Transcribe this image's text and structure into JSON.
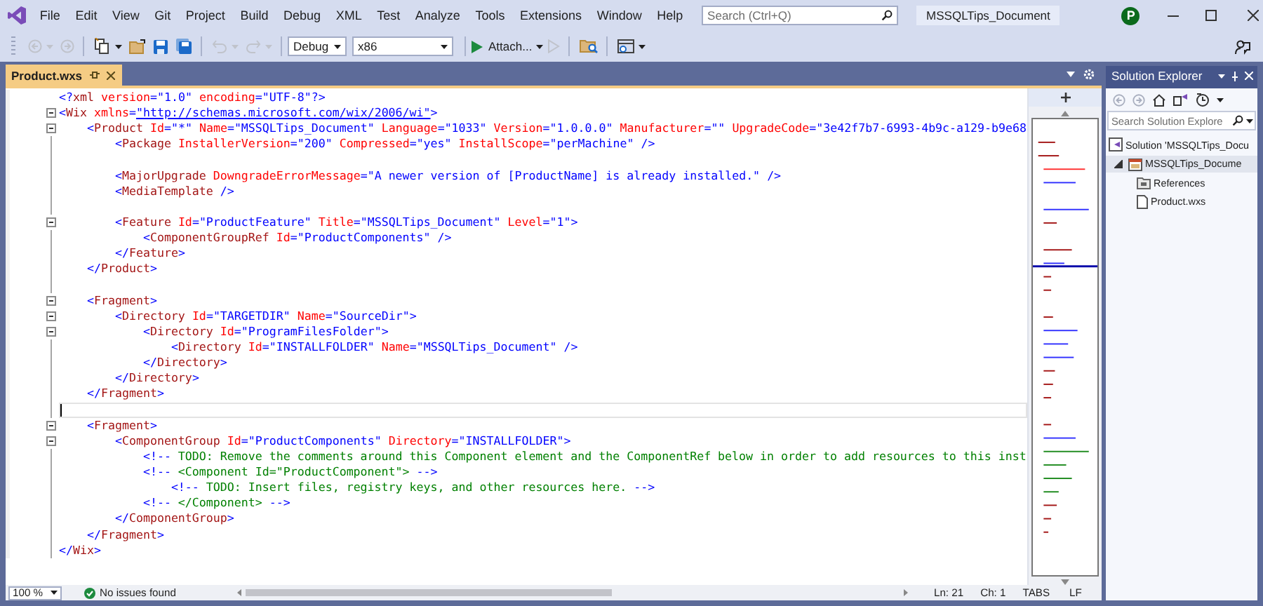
{
  "title_bar": {
    "menu": [
      "File",
      "Edit",
      "View",
      "Git",
      "Project",
      "Build",
      "Debug",
      "XML",
      "Test",
      "Analyze",
      "Tools",
      "Extensions",
      "Window",
      "Help"
    ],
    "search": {
      "placeholder": "Search (Ctrl+Q)"
    },
    "solution_name": "MSSQLTips_Document",
    "account_initial": "P"
  },
  "toolbar": {
    "items": [
      {
        "kind": "back",
        "disabled": true
      },
      {
        "kind": "forward",
        "disabled": true
      },
      {
        "kind": "new-item",
        "disabled": false
      },
      {
        "kind": "open",
        "disabled": false
      },
      {
        "kind": "save",
        "disabled": false
      },
      {
        "kind": "save-all",
        "disabled": false
      },
      {
        "kind": "undo",
        "disabled": true
      },
      {
        "kind": "redo",
        "disabled": true
      },
      {
        "kind": "combo",
        "label": "Debug"
      },
      {
        "kind": "combo",
        "label": "x86"
      },
      {
        "kind": "run",
        "label": "Attach..."
      },
      {
        "kind": "run-outline",
        "disabled": true
      },
      {
        "kind": "find",
        "disabled": false
      },
      {
        "kind": "layout",
        "disabled": false
      }
    ]
  },
  "editor": {
    "tabs": [
      {
        "label": "Product.wxs",
        "selected": true
      }
    ],
    "lines": [
      {
        "text": "<?xml version=\"1.0\" encoding=\"UTF-8\"?>",
        "fold": false,
        "current": false
      },
      {
        "text": "<Wix xmlns=\"http://schemas.microsoft.com/wix/2006/wi\">",
        "fold": true,
        "current": false
      },
      {
        "text": "    <Product Id=\"*\" Name=\"MSSQLTips_Document\" Language=\"1033\" Version=\"1.0.0.0\" Manufacturer=\"\" UpgradeCode=\"3e42f7b7-6993-4b9c-a129-b9e68",
        "fold": true,
        "current": false
      },
      {
        "text": "        <Package InstallerVersion=\"200\" Compressed=\"yes\" InstallScope=\"perMachine\" />",
        "fold": false,
        "current": false
      },
      {
        "fold": false,
        "current": false
      },
      {
        "text": "        <MajorUpgrade DowngradeErrorMessage=\"A newer version of [ProductName] is already installed.\" />",
        "fold": false,
        "current": false
      },
      {
        "text": "        <MediaTemplate />",
        "fold": false,
        "current": false
      },
      {
        "fold": false,
        "current": false
      },
      {
        "text": "        <Feature Id=\"ProductFeature\" Title=\"MSSQLTips_Document\" Level=\"1\">",
        "fold": true,
        "current": false
      },
      {
        "text": "            <ComponentGroupRef Id=\"ProductComponents\" />",
        "fold": false,
        "current": false
      },
      {
        "text": "        </Feature>",
        "fold": false,
        "current": false
      },
      {
        "text": "    </Product>",
        "fold": false,
        "current": false
      },
      {
        "fold": false,
        "current": false
      },
      {
        "text": "    <Fragment>",
        "fold": true,
        "current": false
      },
      {
        "text": "        <Directory Id=\"TARGETDIR\" Name=\"SourceDir\">",
        "fold": true,
        "current": false
      },
      {
        "text": "            <Directory Id=\"ProgramFilesFolder\">",
        "fold": true,
        "current": false
      },
      {
        "text": "                <Directory Id=\"INSTALLFOLDER\" Name=\"MSSQLTips_Document\" />",
        "fold": false,
        "current": false
      },
      {
        "text": "            </Directory>",
        "fold": false,
        "current": false
      },
      {
        "text": "        </Directory>",
        "fold": false,
        "current": false
      },
      {
        "text": "    </Fragment>",
        "fold": false,
        "current": false
      },
      {
        "fold": false,
        "current": true
      },
      {
        "text": "    <Fragment>",
        "fold": true,
        "current": false
      },
      {
        "text": "        <ComponentGroup Id=\"ProductComponents\" Directory=\"INSTALLFOLDER\">",
        "fold": true,
        "current": false
      },
      {
        "text": "            <!-- TODO: Remove the comments around this Component element and the ComponentRef below in order to add resources to this inst",
        "fold": false,
        "current": false
      },
      {
        "text": "            <!-- <Component Id=\"ProductComponent\"> -->",
        "fold": false,
        "current": false
      },
      {
        "text": "                <!-- TODO: Insert files, registry keys, and other resources here. -->",
        "fold": false,
        "current": false
      },
      {
        "text": "            <!-- </Component> -->",
        "fold": false,
        "current": false
      },
      {
        "text": "        </ComponentGroup>",
        "fold": false,
        "current": false
      },
      {
        "text": "    </Fragment>",
        "fold": false,
        "current": false
      },
      {
        "text": "</Wix>",
        "fold": false,
        "current": false
      }
    ],
    "status": {
      "zoom": "100 %",
      "issues": "No issues found",
      "line": "Ln: 21",
      "column": "Ch: 1",
      "indent": "TABS",
      "line_ending": "LF"
    }
  },
  "solution_explorer": {
    "title": "Solution Explorer",
    "search": {
      "placeholder": "Search Solution Explore"
    },
    "tree": [
      {
        "label": "Solution 'MSSQLTips_Docu",
        "kind": "solution",
        "selected": false,
        "children": [
          {
            "label": "MSSQLTips_Docume",
            "kind": "project",
            "selected": true,
            "expanded": true,
            "children": [
              {
                "label": "References",
                "kind": "references",
                "selected": false
              },
              {
                "label": "Product.wxs",
                "kind": "file",
                "selected": false
              }
            ]
          }
        ]
      }
    ]
  }
}
